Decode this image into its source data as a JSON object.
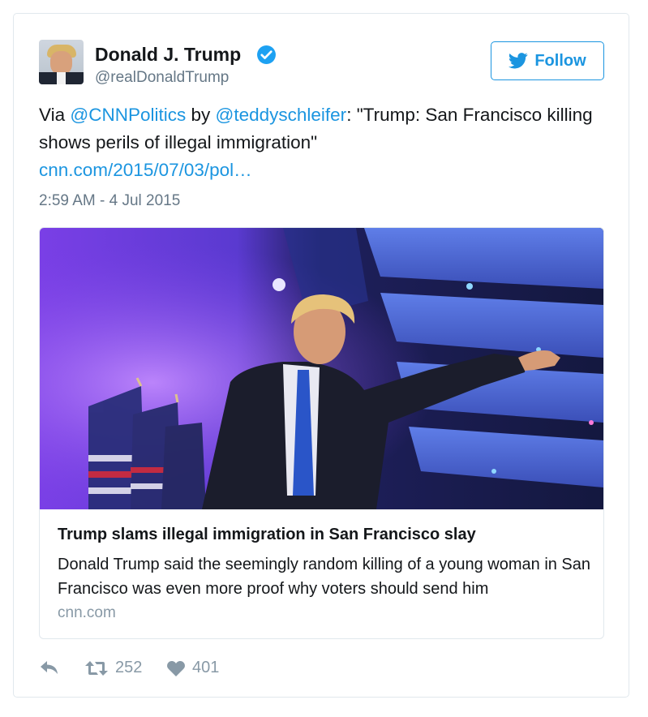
{
  "user": {
    "name": "Donald J. Trump",
    "handle": "@realDonaldTrump",
    "verified": true
  },
  "follow_button": {
    "label": "Follow",
    "icon": "twitter-bird-icon"
  },
  "tweet": {
    "text_prefix": "Via ",
    "mention1": "@CNNPolitics",
    "text_by": " by ",
    "mention2": "@teddyschleifer",
    "text_quote": ": \"Trump: San Francisco killing shows perils of illegal immigration\"",
    "link": "cnn.com/2015/07/03/pol…",
    "timestamp": "2:59 AM - 4 Jul 2015"
  },
  "card": {
    "title": "Trump slams illegal immigration in San Francisco slay",
    "description": "Donald Trump said the seemingly random killing of a young woman in San Francisco was even more proof why voters should send him",
    "domain": "cnn.com"
  },
  "actions": {
    "retweets": "252",
    "likes": "401"
  },
  "colors": {
    "accent": "#1b95e0",
    "muted": "#657786",
    "border": "#e1e8ed"
  }
}
